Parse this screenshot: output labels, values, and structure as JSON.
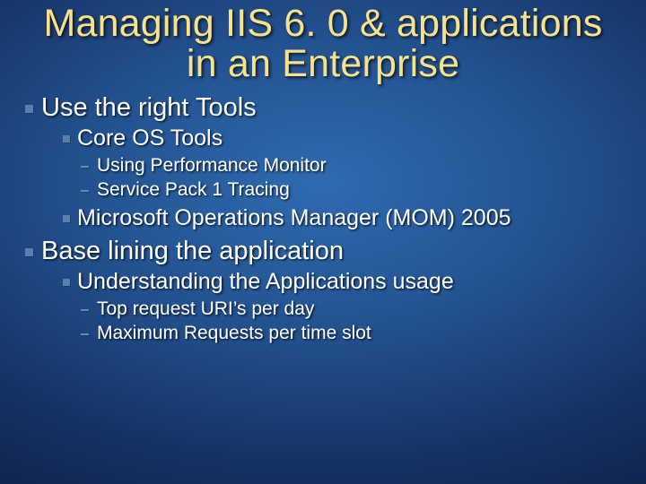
{
  "title_line1": "Managing IIS 6. 0 & applications",
  "title_line2": "in an Enterprise",
  "bullets": {
    "l1a": "Use the right Tools",
    "l2a": "Core OS Tools",
    "l3a": "Using Performance Monitor",
    "l3b": "Service Pack 1 Tracing",
    "l2b": "Microsoft Operations Manager (MOM) 2005",
    "l1b": "Base lining the application",
    "l2c": "Understanding the Applications usage",
    "l3c": "Top request URI’s per day",
    "l3d": "Maximum Requests per time slot"
  }
}
